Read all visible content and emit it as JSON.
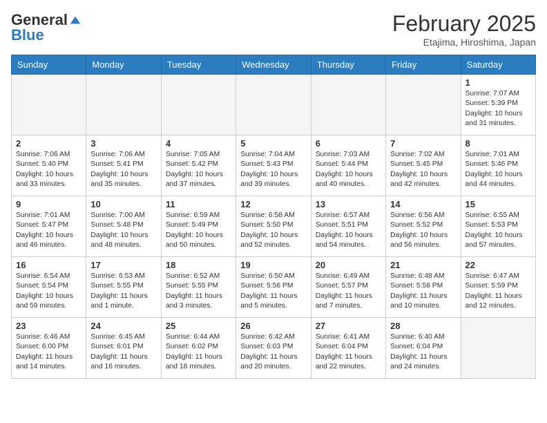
{
  "header": {
    "logo_general": "General",
    "logo_blue": "Blue",
    "month_year": "February 2025",
    "location": "Etajima, Hiroshima, Japan"
  },
  "weekdays": [
    "Sunday",
    "Monday",
    "Tuesday",
    "Wednesday",
    "Thursday",
    "Friday",
    "Saturday"
  ],
  "weeks": [
    [
      {
        "day": "",
        "content": ""
      },
      {
        "day": "",
        "content": ""
      },
      {
        "day": "",
        "content": ""
      },
      {
        "day": "",
        "content": ""
      },
      {
        "day": "",
        "content": ""
      },
      {
        "day": "",
        "content": ""
      },
      {
        "day": "1",
        "content": "Sunrise: 7:07 AM\nSunset: 5:39 PM\nDaylight: 10 hours and 31 minutes."
      }
    ],
    [
      {
        "day": "2",
        "content": "Sunrise: 7:06 AM\nSunset: 5:40 PM\nDaylight: 10 hours and 33 minutes."
      },
      {
        "day": "3",
        "content": "Sunrise: 7:06 AM\nSunset: 5:41 PM\nDaylight: 10 hours and 35 minutes."
      },
      {
        "day": "4",
        "content": "Sunrise: 7:05 AM\nSunset: 5:42 PM\nDaylight: 10 hours and 37 minutes."
      },
      {
        "day": "5",
        "content": "Sunrise: 7:04 AM\nSunset: 5:43 PM\nDaylight: 10 hours and 39 minutes."
      },
      {
        "day": "6",
        "content": "Sunrise: 7:03 AM\nSunset: 5:44 PM\nDaylight: 10 hours and 40 minutes."
      },
      {
        "day": "7",
        "content": "Sunrise: 7:02 AM\nSunset: 5:45 PM\nDaylight: 10 hours and 42 minutes."
      },
      {
        "day": "8",
        "content": "Sunrise: 7:01 AM\nSunset: 5:46 PM\nDaylight: 10 hours and 44 minutes."
      }
    ],
    [
      {
        "day": "9",
        "content": "Sunrise: 7:01 AM\nSunset: 5:47 PM\nDaylight: 10 hours and 46 minutes."
      },
      {
        "day": "10",
        "content": "Sunrise: 7:00 AM\nSunset: 5:48 PM\nDaylight: 10 hours and 48 minutes."
      },
      {
        "day": "11",
        "content": "Sunrise: 6:59 AM\nSunset: 5:49 PM\nDaylight: 10 hours and 50 minutes."
      },
      {
        "day": "12",
        "content": "Sunrise: 6:58 AM\nSunset: 5:50 PM\nDaylight: 10 hours and 52 minutes."
      },
      {
        "day": "13",
        "content": "Sunrise: 6:57 AM\nSunset: 5:51 PM\nDaylight: 10 hours and 54 minutes."
      },
      {
        "day": "14",
        "content": "Sunrise: 6:56 AM\nSunset: 5:52 PM\nDaylight: 10 hours and 56 minutes."
      },
      {
        "day": "15",
        "content": "Sunrise: 6:55 AM\nSunset: 5:53 PM\nDaylight: 10 hours and 57 minutes."
      }
    ],
    [
      {
        "day": "16",
        "content": "Sunrise: 6:54 AM\nSunset: 5:54 PM\nDaylight: 10 hours and 59 minutes."
      },
      {
        "day": "17",
        "content": "Sunrise: 6:53 AM\nSunset: 5:55 PM\nDaylight: 11 hours and 1 minute."
      },
      {
        "day": "18",
        "content": "Sunrise: 6:52 AM\nSunset: 5:55 PM\nDaylight: 11 hours and 3 minutes."
      },
      {
        "day": "19",
        "content": "Sunrise: 6:50 AM\nSunset: 5:56 PM\nDaylight: 11 hours and 5 minutes."
      },
      {
        "day": "20",
        "content": "Sunrise: 6:49 AM\nSunset: 5:57 PM\nDaylight: 11 hours and 7 minutes."
      },
      {
        "day": "21",
        "content": "Sunrise: 6:48 AM\nSunset: 5:58 PM\nDaylight: 11 hours and 10 minutes."
      },
      {
        "day": "22",
        "content": "Sunrise: 6:47 AM\nSunset: 5:59 PM\nDaylight: 11 hours and 12 minutes."
      }
    ],
    [
      {
        "day": "23",
        "content": "Sunrise: 6:46 AM\nSunset: 6:00 PM\nDaylight: 11 hours and 14 minutes."
      },
      {
        "day": "24",
        "content": "Sunrise: 6:45 AM\nSunset: 6:01 PM\nDaylight: 11 hours and 16 minutes."
      },
      {
        "day": "25",
        "content": "Sunrise: 6:44 AM\nSunset: 6:02 PM\nDaylight: 11 hours and 18 minutes."
      },
      {
        "day": "26",
        "content": "Sunrise: 6:42 AM\nSunset: 6:03 PM\nDaylight: 11 hours and 20 minutes."
      },
      {
        "day": "27",
        "content": "Sunrise: 6:41 AM\nSunset: 6:04 PM\nDaylight: 11 hours and 22 minutes."
      },
      {
        "day": "28",
        "content": "Sunrise: 6:40 AM\nSunset: 6:04 PM\nDaylight: 11 hours and 24 minutes."
      },
      {
        "day": "",
        "content": ""
      }
    ]
  ]
}
